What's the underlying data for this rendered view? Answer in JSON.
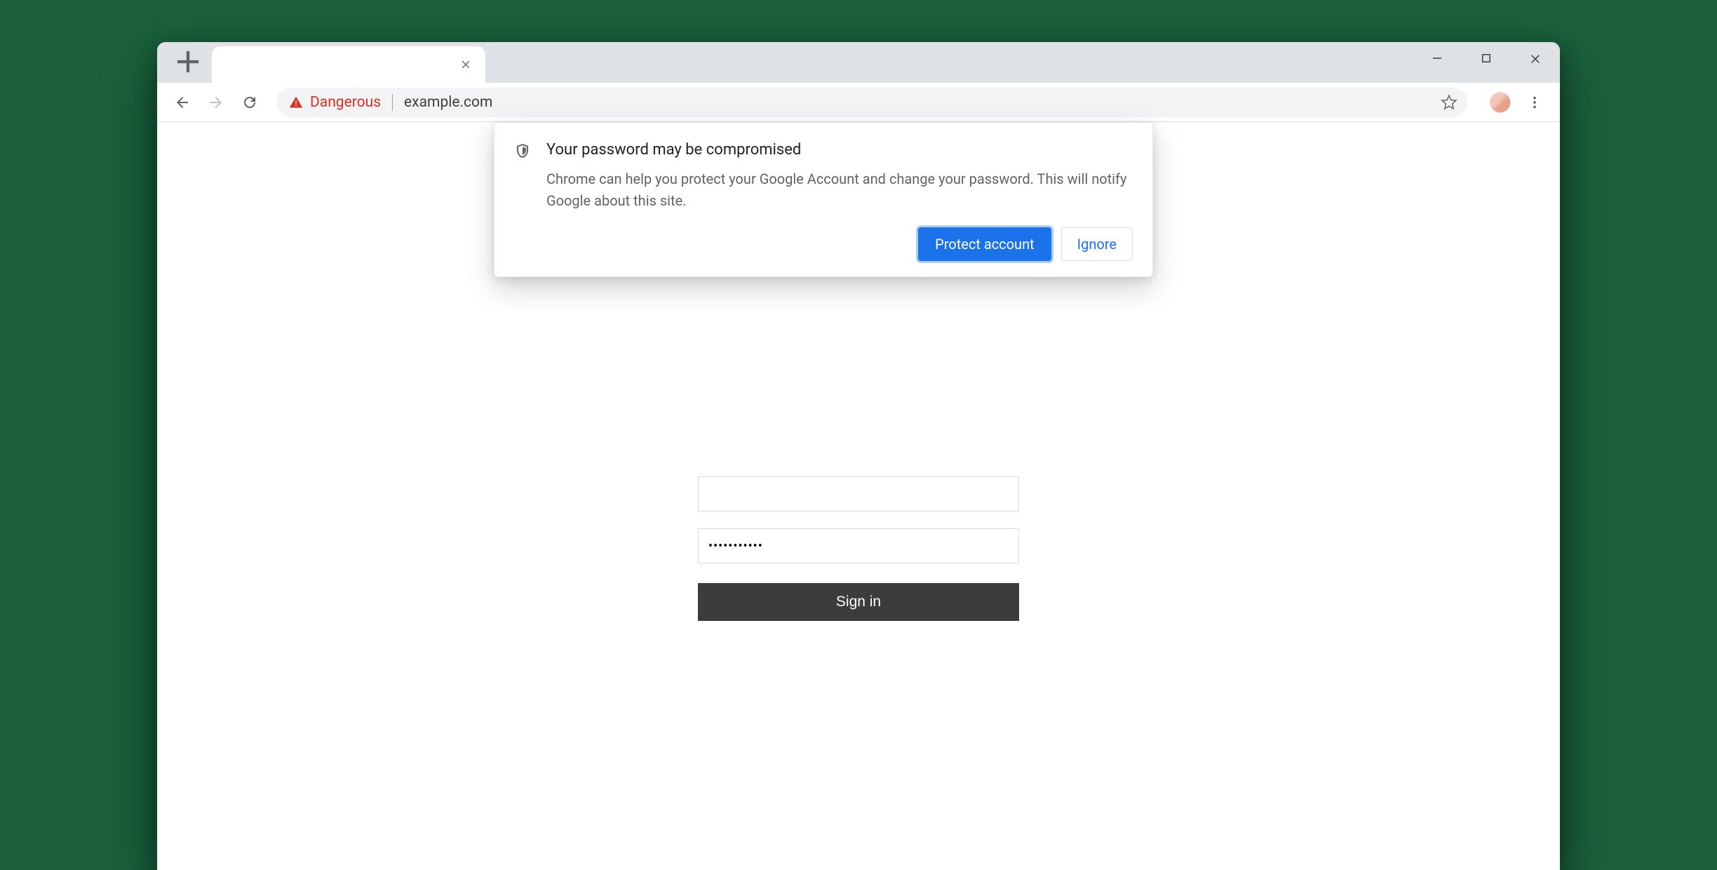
{
  "browser": {
    "tab_title": "",
    "security_label": "Dangerous",
    "url": "example.com"
  },
  "popup": {
    "title": "Your password may be compromised",
    "body": "Chrome can help you protect your Google Account and change your password. This will notify Google about this site.",
    "primary_label": "Protect account",
    "secondary_label": "Ignore"
  },
  "login": {
    "username_value": "",
    "password_value": "•••••••••••",
    "submit_label": "Sign in"
  }
}
